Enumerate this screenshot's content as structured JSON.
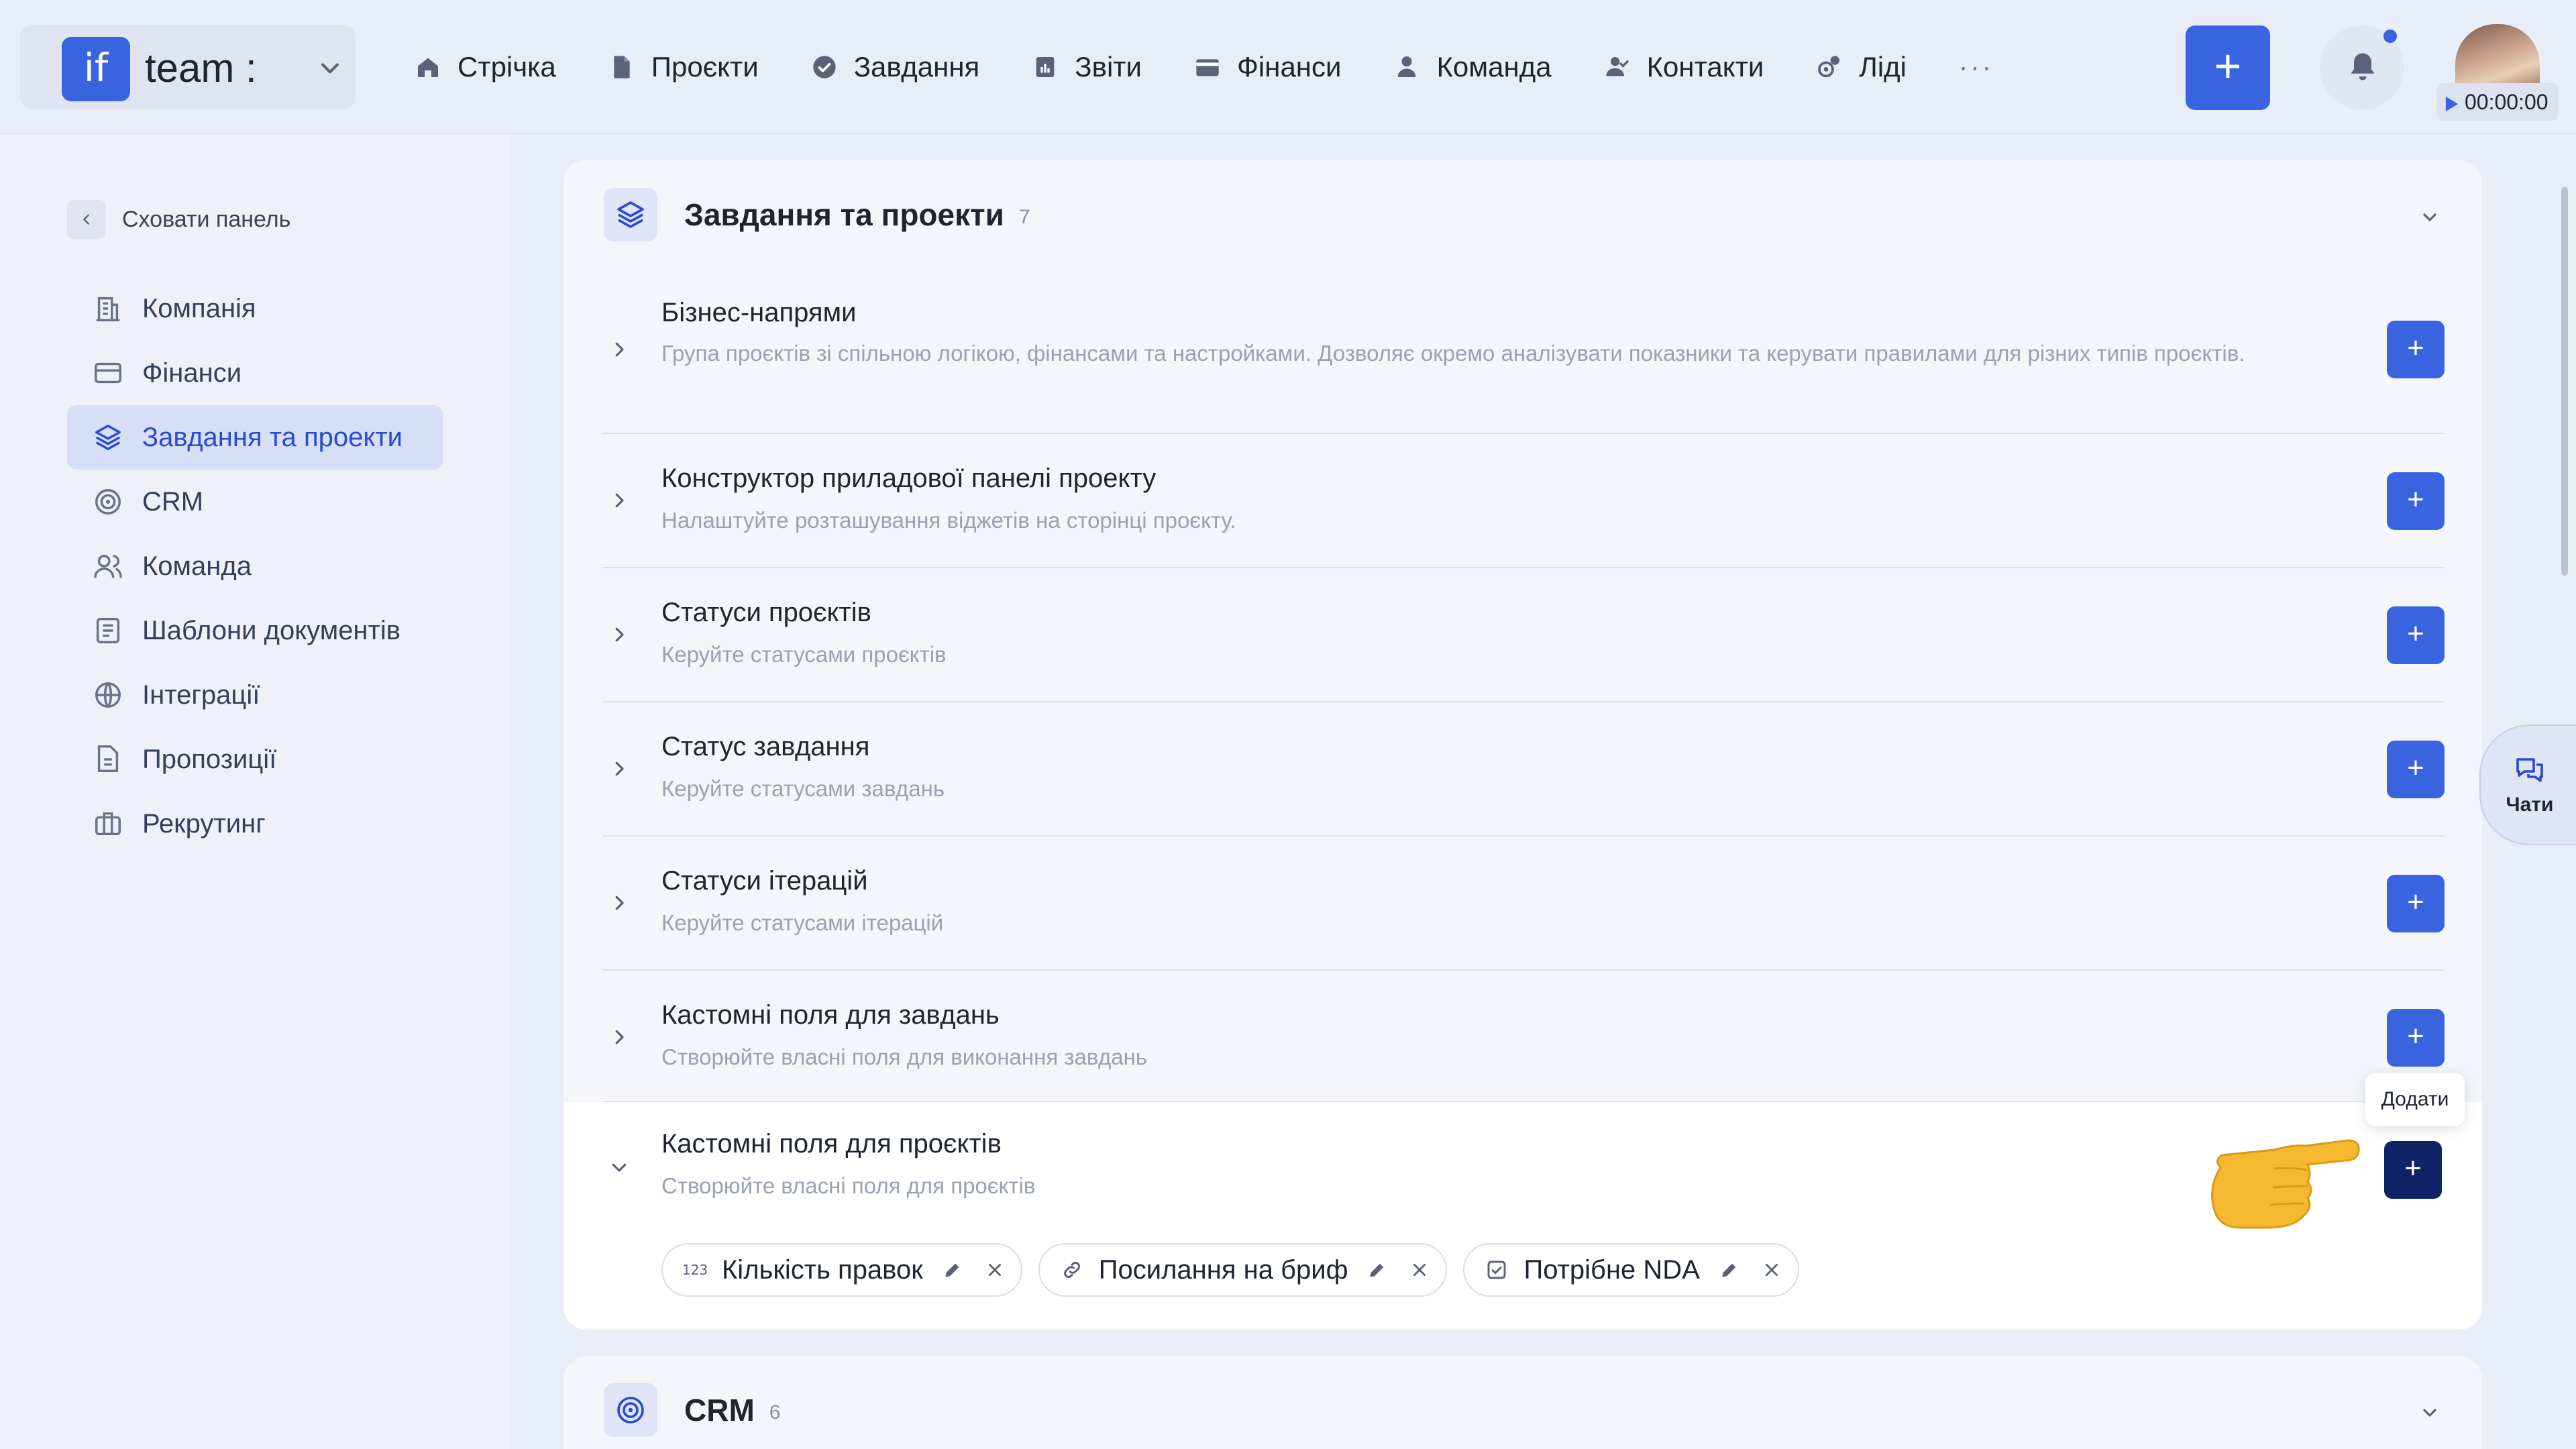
{
  "brand": {
    "logo": "if",
    "name": "team :"
  },
  "nav": {
    "items": [
      {
        "label": "Стрічка",
        "icon": "home-icon"
      },
      {
        "label": "Проєкти",
        "icon": "document-icon"
      },
      {
        "label": "Завдання",
        "icon": "check-circle-icon"
      },
      {
        "label": "Звіти",
        "icon": "report-icon"
      },
      {
        "label": "Фінанси",
        "icon": "wallet-icon"
      },
      {
        "label": "Команда",
        "icon": "user-icon"
      },
      {
        "label": "Контакти",
        "icon": "contacts-icon"
      },
      {
        "label": "Ліді",
        "icon": "leads-icon"
      }
    ],
    "more": "···",
    "add_label": "+",
    "timer": "00:00:00"
  },
  "sidebar": {
    "hide_label": "Сховати панель",
    "items": [
      {
        "label": "Компанія",
        "icon": "company-icon"
      },
      {
        "label": "Фінанси",
        "icon": "card-icon"
      },
      {
        "label": "Завдання та проекти",
        "icon": "layers-icon",
        "active": true
      },
      {
        "label": "CRM",
        "icon": "target-icon"
      },
      {
        "label": "Команда",
        "icon": "team-icon"
      },
      {
        "label": "Шаблони документів",
        "icon": "template-icon"
      },
      {
        "label": "Інтеграції",
        "icon": "globe-icon"
      },
      {
        "label": "Пропозиції",
        "icon": "proposal-icon"
      },
      {
        "label": "Рекрутинг",
        "icon": "briefcase-icon"
      }
    ]
  },
  "section": {
    "title": "Завдання та проекти",
    "count": "7",
    "rows": [
      {
        "title": "Бізнес-напрями",
        "desc": "Група проєктів зі спільною логікою, фінансами та настройками. Дозволяє окремо аналізувати показники та керувати правилами для різних типів проєктів."
      },
      {
        "title": "Конструктор приладової панелі проекту",
        "desc": "Налаштуйте розташування віджетів на сторінці проєкту."
      },
      {
        "title": "Статуси проєктів",
        "desc": "Керуйте статусами проєктів"
      },
      {
        "title": "Статус завдання",
        "desc": "Керуйте статусами завдань"
      },
      {
        "title": "Статуси ітерацій",
        "desc": "Керуйте статусами ітерацій"
      },
      {
        "title": "Кастомні поля для завдань",
        "desc": "Створюйте власні поля для виконання завдань"
      }
    ],
    "expanded": {
      "title": "Кастомні поля для проєктів",
      "desc": "Створюйте власні поля для проєктів",
      "chips": [
        {
          "label": "Кількість правок",
          "icon_text": "123"
        },
        {
          "label": "Посилання на бриф",
          "icon": "link-icon"
        },
        {
          "label": "Потрібне NDA",
          "icon": "checkbox-icon"
        }
      ]
    },
    "add_symbol": "+",
    "tooltip": "Додати"
  },
  "crm": {
    "title": "CRM",
    "count": "6"
  },
  "chats": {
    "label": "Чати"
  },
  "colors": {
    "accent": "#3a63e0",
    "accent_dark": "#0f2466",
    "active_bg": "#d7dff7"
  }
}
